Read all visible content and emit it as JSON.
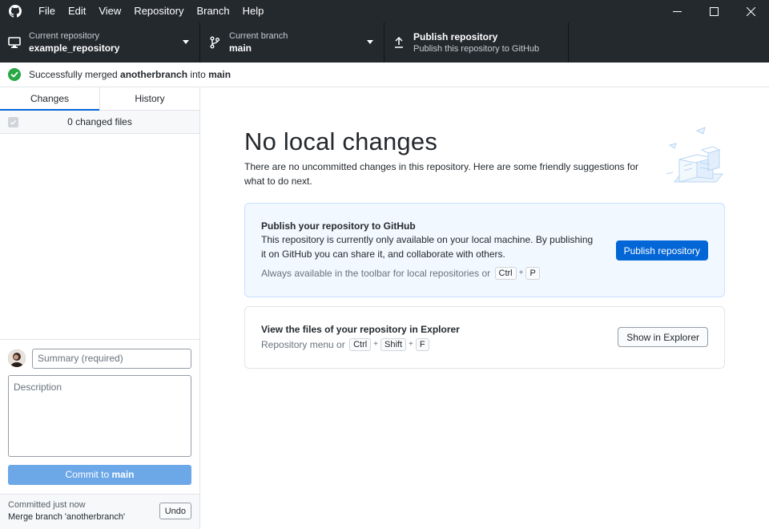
{
  "titlebar": {
    "logo_icon": "github-logo-icon",
    "menu": [
      "File",
      "Edit",
      "View",
      "Repository",
      "Branch",
      "Help"
    ],
    "window_controls": [
      "minimize-icon",
      "maximize-icon",
      "close-icon"
    ]
  },
  "toolbar": {
    "repository": {
      "desc": "Current repository",
      "title": "example_repository",
      "icon": "computer-icon"
    },
    "branch": {
      "desc": "Current branch",
      "title": "main",
      "icon": "branch-icon"
    },
    "publish": {
      "title": "Publish repository",
      "desc": "Publish this repository to GitHub",
      "icon": "upload-icon"
    }
  },
  "banner": {
    "prefix": "Successfully merged ",
    "source_branch": "anotherbranch",
    "middle": " into ",
    "target_branch": "main",
    "icon": "check-circle-icon",
    "color": "#28a745"
  },
  "sidebar": {
    "tabs": [
      {
        "label": "Changes",
        "active": true
      },
      {
        "label": "History",
        "active": false
      }
    ],
    "changed_files": "0 changed files",
    "commit": {
      "summary_placeholder": "Summary (required)",
      "description_placeholder": "Description",
      "button_prefix": "Commit to ",
      "button_branch": "main"
    },
    "last_commit": {
      "when": "Committed just now",
      "message": "Merge branch 'anotherbranch'",
      "undo_label": "Undo"
    }
  },
  "main": {
    "heading": "No local changes",
    "subtext": "There are no uncommitted changes in this repository. Here are some friendly suggestions for what to do next.",
    "publish_card": {
      "title": "Publish your repository to GitHub",
      "body": "This repository is currently only available on your local machine. By publishing it on GitHub you can share it, and collaborate with others.",
      "hint": "Always available in the toolbar for local repositories or",
      "keys": [
        "Ctrl",
        "P"
      ],
      "button": "Publish repository"
    },
    "explorer_card": {
      "title": "View the files of your repository in Explorer",
      "hint": "Repository menu or",
      "keys": [
        "Ctrl",
        "Shift",
        "F"
      ],
      "button": "Show in Explorer"
    }
  },
  "colors": {
    "chrome": "#24292e",
    "accent": "#0366d6",
    "commit_button": "#6ca7e7",
    "publish_card_bg": "#f1f8ff"
  }
}
